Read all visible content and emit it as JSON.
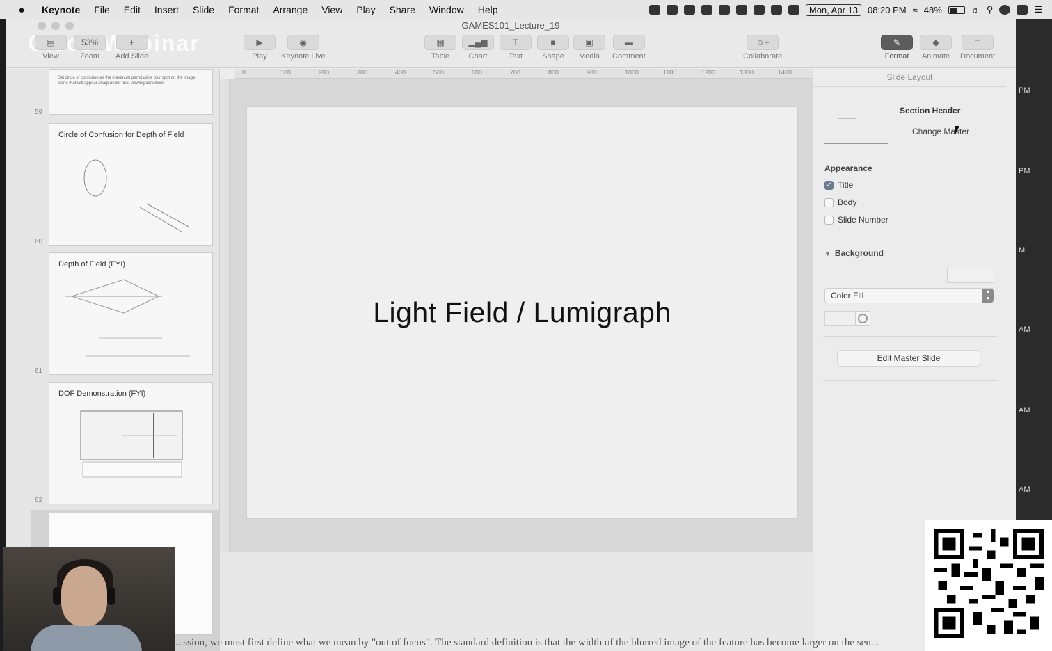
{
  "menubar": {
    "app_name": "Keynote",
    "items": [
      "File",
      "Edit",
      "Insert",
      "Slide",
      "Format",
      "Arrange",
      "View",
      "Play",
      "Share",
      "Window",
      "Help"
    ],
    "date": "Mon, Apr 13",
    "time": "08:20 PM",
    "battery_percent": "48%",
    "battery_level": 0.48
  },
  "window": {
    "title": "GAMES101_Lecture_19",
    "watermark": "Cisco Webinar"
  },
  "toolbar": {
    "view_label": "View",
    "zoom_label": "Zoom",
    "zoom_value": "53%",
    "add_slide_label": "Add Slide",
    "play_label": "Play",
    "keynote_live_label": "Keynote Live",
    "table_label": "Table",
    "chart_label": "Chart",
    "text_label": "Text",
    "shape_label": "Shape",
    "media_label": "Media",
    "comment_label": "Comment",
    "collaborate_label": "Collaborate",
    "format_label": "Format",
    "animate_label": "Animate",
    "document_label": "Document"
  },
  "ruler": {
    "marks": [
      "0",
      "100",
      "200",
      "300",
      "400",
      "500",
      "600",
      "700",
      "800",
      "900",
      "1000",
      "1100",
      "1200",
      "1300",
      "1400"
    ]
  },
  "navigator": {
    "slides": [
      {
        "number": "59",
        "title": "",
        "text": "Set circle of confusion as the maximum permissible blur spot on the image plane that will appear sharp under final viewing conditions"
      },
      {
        "number": "60",
        "title": "Circle of Confusion for Depth of Field",
        "text": ""
      },
      {
        "number": "61",
        "title": "Depth of Field (FYI)",
        "text": ""
      },
      {
        "number": "62",
        "title": "DOF Demonstration (FYI)",
        "text": ""
      }
    ]
  },
  "slide": {
    "title": "Light Field / Lumigraph"
  },
  "inspector": {
    "tab_label": "Slide Layout",
    "layout_name": "Section Header",
    "change_master_label": "Change Master",
    "appearance_label": "Appearance",
    "checks": [
      {
        "label": "Title",
        "checked": true
      },
      {
        "label": "Body",
        "checked": false
      },
      {
        "label": "Slide Number",
        "checked": false
      }
    ],
    "background_label": "Background",
    "fill_type": "Color Fill",
    "edit_master_label": "Edit Master Slide"
  },
  "subtitle": "...ssion, we must first define what we mean by \"out of focus\". The standard definition is that the width of the blurred image of the feature has become larger on the sen...",
  "right_strip": {
    "labels": [
      "PM",
      "PM",
      "M",
      "AM",
      "AM",
      "AM"
    ]
  }
}
